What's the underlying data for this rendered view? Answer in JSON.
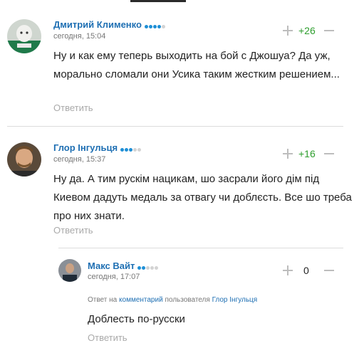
{
  "comments": [
    {
      "author": "Дмитрий Клименко",
      "time": "сегодня, 15:04",
      "rating_dots_filled": 4,
      "score": "+26",
      "text": "Ну и как ему теперь выходить на бой с Джошуа? Да уж, морально сломали они Усика таким жестким решением...",
      "reply_label": "Ответить"
    },
    {
      "author": "Глор Інгульця",
      "time": "сегодня, 15:37",
      "rating_dots_filled": 3,
      "score": "+16",
      "text": "Ну да. А тим рускім нацикам, шо засрали його дім під Киевом дадуть медаль за отвагу чи доблєсть. Все шо треба про них знати.",
      "reply_label": "Ответить"
    },
    {
      "author": "Макс Вайт",
      "time": "сегодня, 17:07",
      "rating_dots_filled": 2,
      "score": "0",
      "reply_to": {
        "prefix": "Ответ на",
        "link": "комментарий",
        "middle": "пользователя",
        "user": "Глор Інгульця"
      },
      "text": "Доблесть по-русски",
      "reply_label": "Ответить"
    }
  ],
  "colors": {
    "author_link": "#1e6fb3",
    "positive_score": "#2e9e2e",
    "rating_dot_on": "#1e8fd6",
    "rating_dot_off": "#d3d3d3"
  },
  "icons": {
    "upvote": "plus-icon",
    "downvote": "minus-icon"
  }
}
